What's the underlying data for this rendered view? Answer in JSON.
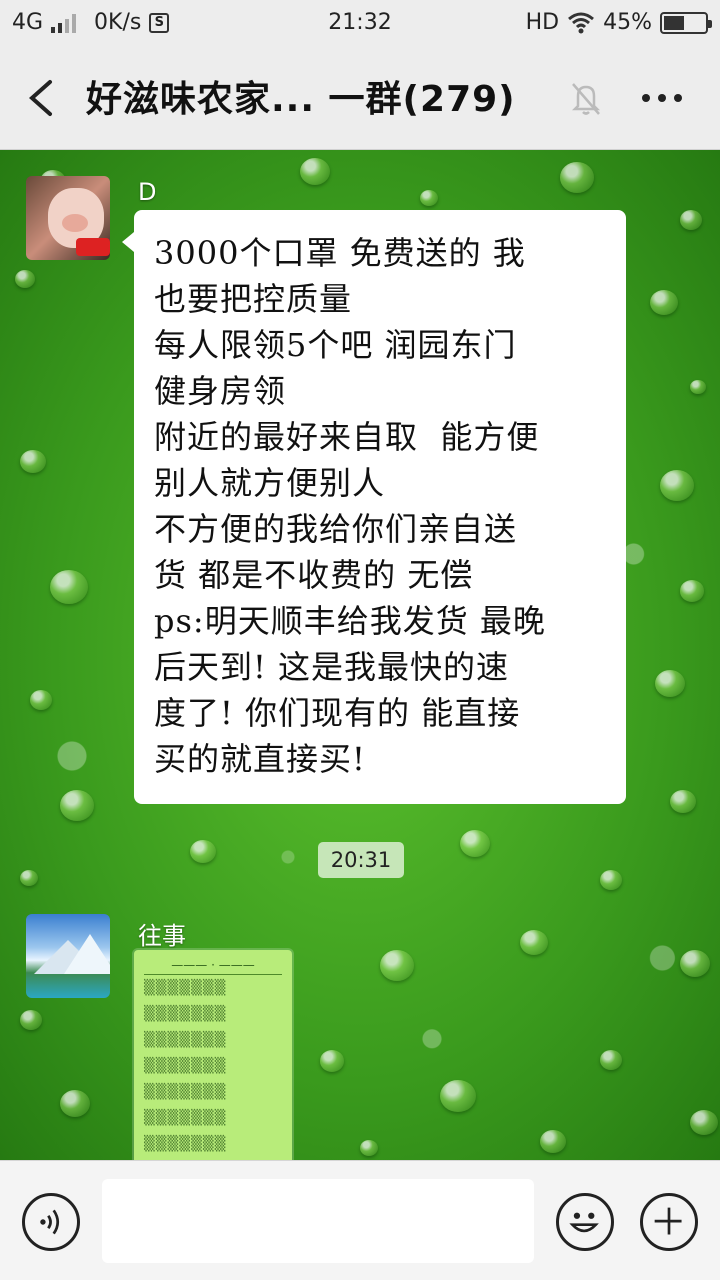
{
  "status_bar": {
    "network": "4G",
    "speed": "0K/s",
    "s_badge": "S",
    "time": "21:32",
    "hd": "HD",
    "battery": "45%",
    "battery_level": 0.45
  },
  "header": {
    "title": "好滋味农家... 一群(279)",
    "icons": [
      "back-icon",
      "mute-bell-icon",
      "more-icon"
    ]
  },
  "messages": [
    {
      "sender": "D",
      "text": "3000个口罩 免费送的 我\n也要把控质量\n每人限领5个吧 润园东门\n健身房领\n附近的最好来自取  能方便\n别人就方便别人\n不方便的我给你们亲自送\n货 都是不收费的 无偿\nps:明天顺丰给我发货 最晚\n后天到! 这是我最快的速\n度了! 你们现有的 能直接\n买的就直接买!"
    },
    {
      "sender": "往事",
      "type": "image"
    }
  ],
  "time_divider": "20:31",
  "input_bar": {
    "icons": [
      "voice-icon",
      "emoji-icon",
      "plus-icon"
    ]
  },
  "colors": {
    "chat_bg": "#3a9a1d",
    "bubble_bg": "#ffffff",
    "bar_bg": "#ededed"
  }
}
